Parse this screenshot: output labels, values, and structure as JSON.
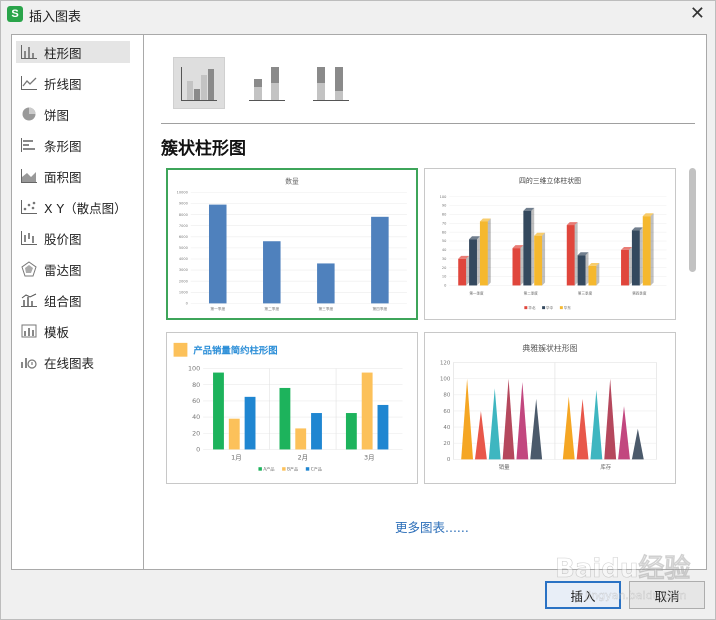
{
  "window": {
    "title": "插入图表",
    "app_icon_letter": "S"
  },
  "sidebar": {
    "items": [
      {
        "label": "柱形图",
        "icon": "column-chart-icon",
        "selected": true
      },
      {
        "label": "折线图",
        "icon": "line-chart-icon"
      },
      {
        "label": "饼图",
        "icon": "pie-chart-icon"
      },
      {
        "label": "条形图",
        "icon": "bar-chart-icon"
      },
      {
        "label": "面积图",
        "icon": "area-chart-icon"
      },
      {
        "label": "X Y（散点图）",
        "icon": "scatter-chart-icon"
      },
      {
        "label": "股价图",
        "icon": "stock-chart-icon"
      },
      {
        "label": "雷达图",
        "icon": "radar-chart-icon"
      },
      {
        "label": "组合图",
        "icon": "combo-chart-icon"
      },
      {
        "label": "模板",
        "icon": "template-icon"
      },
      {
        "label": "在线图表",
        "icon": "online-chart-icon"
      }
    ]
  },
  "main": {
    "section_title": "簇状柱形图",
    "subtypes": [
      "clustered-column",
      "stacked-column",
      "percent-stacked-column"
    ],
    "thumbnails": [
      {
        "title": "数量",
        "y_ticks": [
          "10000",
          "9000",
          "8000",
          "7000",
          "6000",
          "5000",
          "4000",
          "3000",
          "2000",
          "1000",
          "0"
        ],
        "categories": [
          "第一季度",
          "第二季度",
          "第三季度",
          "第四季度"
        ],
        "values": [
          8900,
          5600,
          3600,
          7800
        ],
        "color": "#4f81bd"
      },
      {
        "title": "四的三维立体柱状图",
        "y_ticks": [
          "100",
          "90",
          "80",
          "70",
          "60",
          "50",
          "40",
          "30",
          "20",
          "10",
          "0"
        ],
        "categories": [
          "第一季度",
          "第二季度",
          "第三季度",
          "第四季度"
        ],
        "series": [
          {
            "name": "华北",
            "color": "#e0463c",
            "values": [
              30,
              42,
              68,
              40
            ]
          },
          {
            "name": "华中",
            "color": "#34495e",
            "values": [
              52,
              84,
              34,
              62
            ]
          },
          {
            "name": "华东",
            "color": "#f5b82e",
            "values": [
              72,
              56,
              22,
              78
            ]
          }
        ]
      },
      {
        "title": "产品销量简约柱形图",
        "y_ticks": [
          "100",
          "80",
          "60",
          "40",
          "20",
          "0"
        ],
        "categories": [
          "1月",
          "2月",
          "3月"
        ],
        "series": [
          {
            "name": "A产品",
            "color": "#1db35c",
            "values": [
              95,
              76,
              45
            ]
          },
          {
            "name": "B产品",
            "color": "#fcc15a",
            "values": [
              38,
              26,
              95
            ]
          },
          {
            "name": "C产品",
            "color": "#1f86d1",
            "values": [
              65,
              45,
              55
            ]
          }
        ]
      },
      {
        "title": "典雅簇状柱形图",
        "y_ticks": [
          "120",
          "100",
          "80",
          "60",
          "40",
          "20",
          "0"
        ],
        "categories": [
          "销量",
          "库存"
        ],
        "colors": [
          "#f5a623",
          "#e8574a",
          "#3fb6c0",
          "#b5485d",
          "#c2477f",
          "#4b5a6b"
        ],
        "groups": [
          [
            100,
            60,
            88,
            100,
            96,
            75
          ],
          [
            78,
            75,
            86,
            100,
            66,
            38
          ]
        ]
      }
    ],
    "more_link": "更多图表......"
  },
  "footer": {
    "insert_label": "插入",
    "cancel_label": "取消"
  },
  "watermark_text": "Baidu经验 jingyan.baidu.com"
}
